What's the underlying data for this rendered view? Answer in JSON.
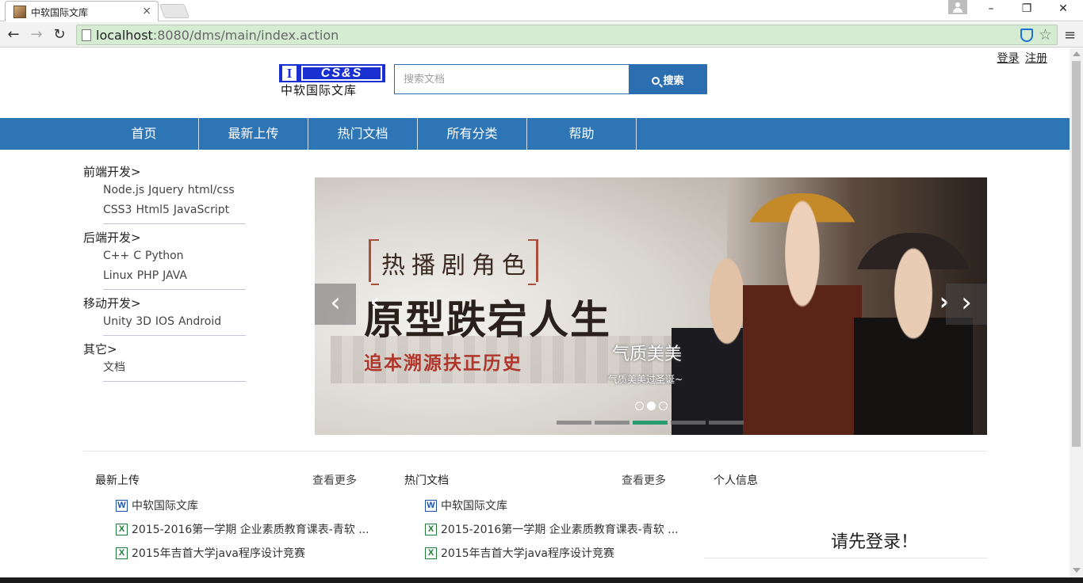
{
  "browser": {
    "tab_title": "中软国际文库",
    "tab_close": "×",
    "url_host": "localhost",
    "url_rest": ":8080/dms/main/index.action",
    "minimize": "–",
    "restore": "❐",
    "close": "✕",
    "back": "←",
    "forward": "→",
    "reload": "↻",
    "star": "☆",
    "menu": "≡"
  },
  "header": {
    "login": "登录",
    "register": "注册",
    "logo_i": "I",
    "logo_cs": "CS&S",
    "logo_text": "中软国际文库",
    "search_placeholder": "搜索文档",
    "search_button": "搜索"
  },
  "nav": [
    "首页",
    "最新上传",
    "热门文档",
    "所有分类",
    "帮助"
  ],
  "categories": [
    {
      "title": "前端开发>",
      "lines": [
        [
          "Node.js",
          "Jquery",
          "html/css"
        ],
        [
          "CSS3",
          "Html5",
          "JavaScript"
        ]
      ]
    },
    {
      "title": "后端开发>",
      "lines": [
        [
          "C++",
          "C",
          "Python"
        ],
        [
          "Linux",
          "PHP",
          "JAVA"
        ]
      ]
    },
    {
      "title": "移动开发>",
      "lines": [
        [
          "Unity 3D",
          "IOS",
          "Android"
        ]
      ]
    },
    {
      "title": "其它>",
      "lines": [
        [
          "文档"
        ]
      ]
    }
  ],
  "banner": {
    "tag": "热播剧角色",
    "headline": "原型跌宕人生",
    "subline": "追本溯源扶正历史",
    "caption_title": "气质美美",
    "caption_sub": "气质美美过圣诞~",
    "prev": "‹",
    "next": "›",
    "active_dot": 1,
    "active_bar": 2
  },
  "latest": {
    "title": "最新上传",
    "more": "查看更多",
    "docs": [
      {
        "type": "word",
        "icon": "W",
        "name": "中软国际文库"
      },
      {
        "type": "excel",
        "icon": "X",
        "name": "2015-2016第一学期 企业素质教育课表-青软 ..."
      },
      {
        "type": "excel",
        "icon": "X",
        "name": "2015年吉首大学java程序设计竞赛"
      }
    ]
  },
  "hot": {
    "title": "热门文档",
    "more": "查看更多",
    "docs": [
      {
        "type": "word",
        "icon": "W",
        "name": "中软国际文库"
      },
      {
        "type": "excel",
        "icon": "X",
        "name": "2015-2016第一学期 企业素质教育课表-青软 ..."
      },
      {
        "type": "excel",
        "icon": "X",
        "name": "2015年吉首大学java程序设计竞赛"
      }
    ]
  },
  "profile": {
    "title": "个人信息",
    "login_prompt": "请先登录！"
  },
  "colors": {
    "nav_bg": "#2e75b6",
    "logo_blue": "#1a2fd0",
    "omnibox_bg": "#d5ecd3",
    "active_bar": "#2a9d6e"
  }
}
